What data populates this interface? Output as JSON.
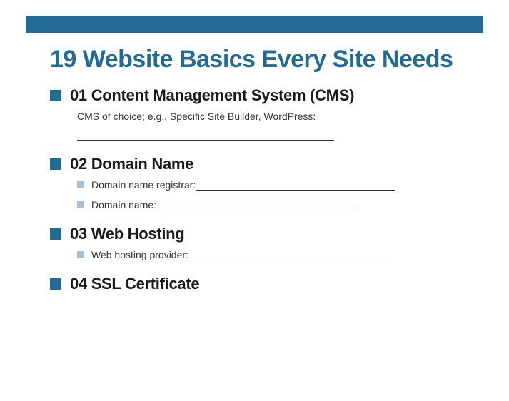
{
  "title": "19 Website Basics Every Site Needs",
  "sections": [
    {
      "number": "01",
      "title": "Content Management System (CMS)",
      "description": "CMS of choice; e.g., Specific Site Builder, WordPress:",
      "has_blank_line": true,
      "sub_items": []
    },
    {
      "number": "02",
      "title": "Domain Name",
      "description": "",
      "has_blank_line": false,
      "sub_items": [
        {
          "label": "Domain name registrar:"
        },
        {
          "label": "Domain name:"
        }
      ]
    },
    {
      "number": "03",
      "title": "Web Hosting",
      "description": "",
      "has_blank_line": false,
      "sub_items": [
        {
          "label": "Web hosting provider:"
        }
      ]
    },
    {
      "number": "04",
      "title": "SSL Certificate",
      "description": "",
      "has_blank_line": false,
      "sub_items": []
    }
  ]
}
